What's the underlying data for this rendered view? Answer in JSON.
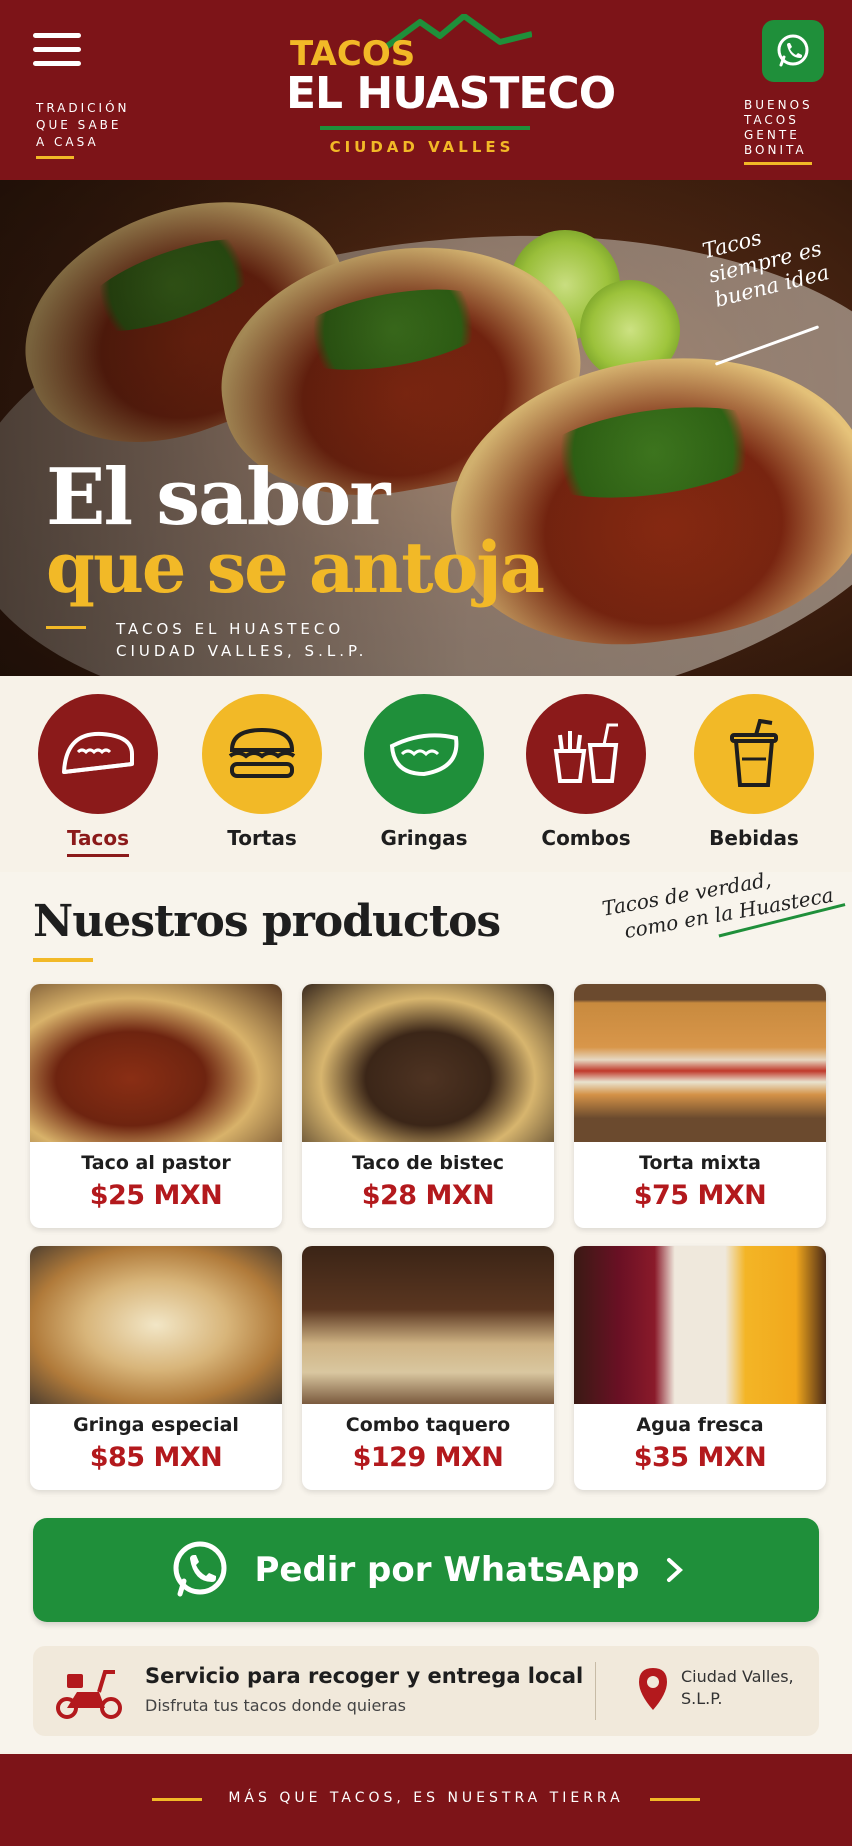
{
  "header": {
    "brand_top": "TACOS",
    "brand_main": "EL HUASTECO",
    "brand_city": "CIUDAD VALLES",
    "tagline_left": [
      "TRADICIÓN",
      "QUE SABE",
      "A CASA"
    ],
    "tagline_right": [
      "BUENOS",
      "TACOS",
      "GENTE",
      "BONITA"
    ]
  },
  "hero": {
    "title_line1": "El sabor",
    "title_line2": "que se antoja",
    "sub_line1": "TACOS EL HUASTECO",
    "sub_line2": "CIUDAD VALLES, S.L.P.",
    "script_lines": [
      "Tacos",
      "siempre es",
      "buena idea"
    ]
  },
  "categories": [
    {
      "label": "Tacos",
      "active": true,
      "color": "#8b1a1a",
      "icon": "taco-icon"
    },
    {
      "label": "Tortas",
      "active": false,
      "color": "#f2b927",
      "icon": "torta-icon"
    },
    {
      "label": "Gringas",
      "active": false,
      "color": "#1f8f3a",
      "icon": "gringa-icon"
    },
    {
      "label": "Combos",
      "active": false,
      "color": "#8b1a1a",
      "icon": "combo-icon"
    },
    {
      "label": "Bebidas",
      "active": false,
      "color": "#f2b927",
      "icon": "drink-icon"
    }
  ],
  "products_section": {
    "title": "Nuestros productos",
    "script_line1": "Tacos de verdad,",
    "script_line2": "como en la Huasteca",
    "items": [
      {
        "name": "Taco al pastor",
        "price": "$25 MXN"
      },
      {
        "name": "Taco de bistec",
        "price": "$28 MXN"
      },
      {
        "name": "Torta mixta",
        "price": "$75 MXN"
      },
      {
        "name": "Gringa especial",
        "price": "$85 MXN"
      },
      {
        "name": "Combo taquero",
        "price": "$129 MXN"
      },
      {
        "name": "Agua fresca",
        "price": "$35 MXN"
      }
    ]
  },
  "cta": {
    "label": "Pedir por WhatsApp"
  },
  "service": {
    "title": "Servicio para recoger y entrega local",
    "subtitle": "Disfruta tus tacos donde quieras",
    "location_line1": "Ciudad Valles,",
    "location_line2": "S.L.P."
  },
  "footer": {
    "text": "MÁS QUE TACOS, ES NUESTRA TIERRA"
  },
  "colors": {
    "maroon": "#7d1418",
    "yellow": "#f2b927",
    "green": "#1f8f3a",
    "price_red": "#b3191d"
  }
}
